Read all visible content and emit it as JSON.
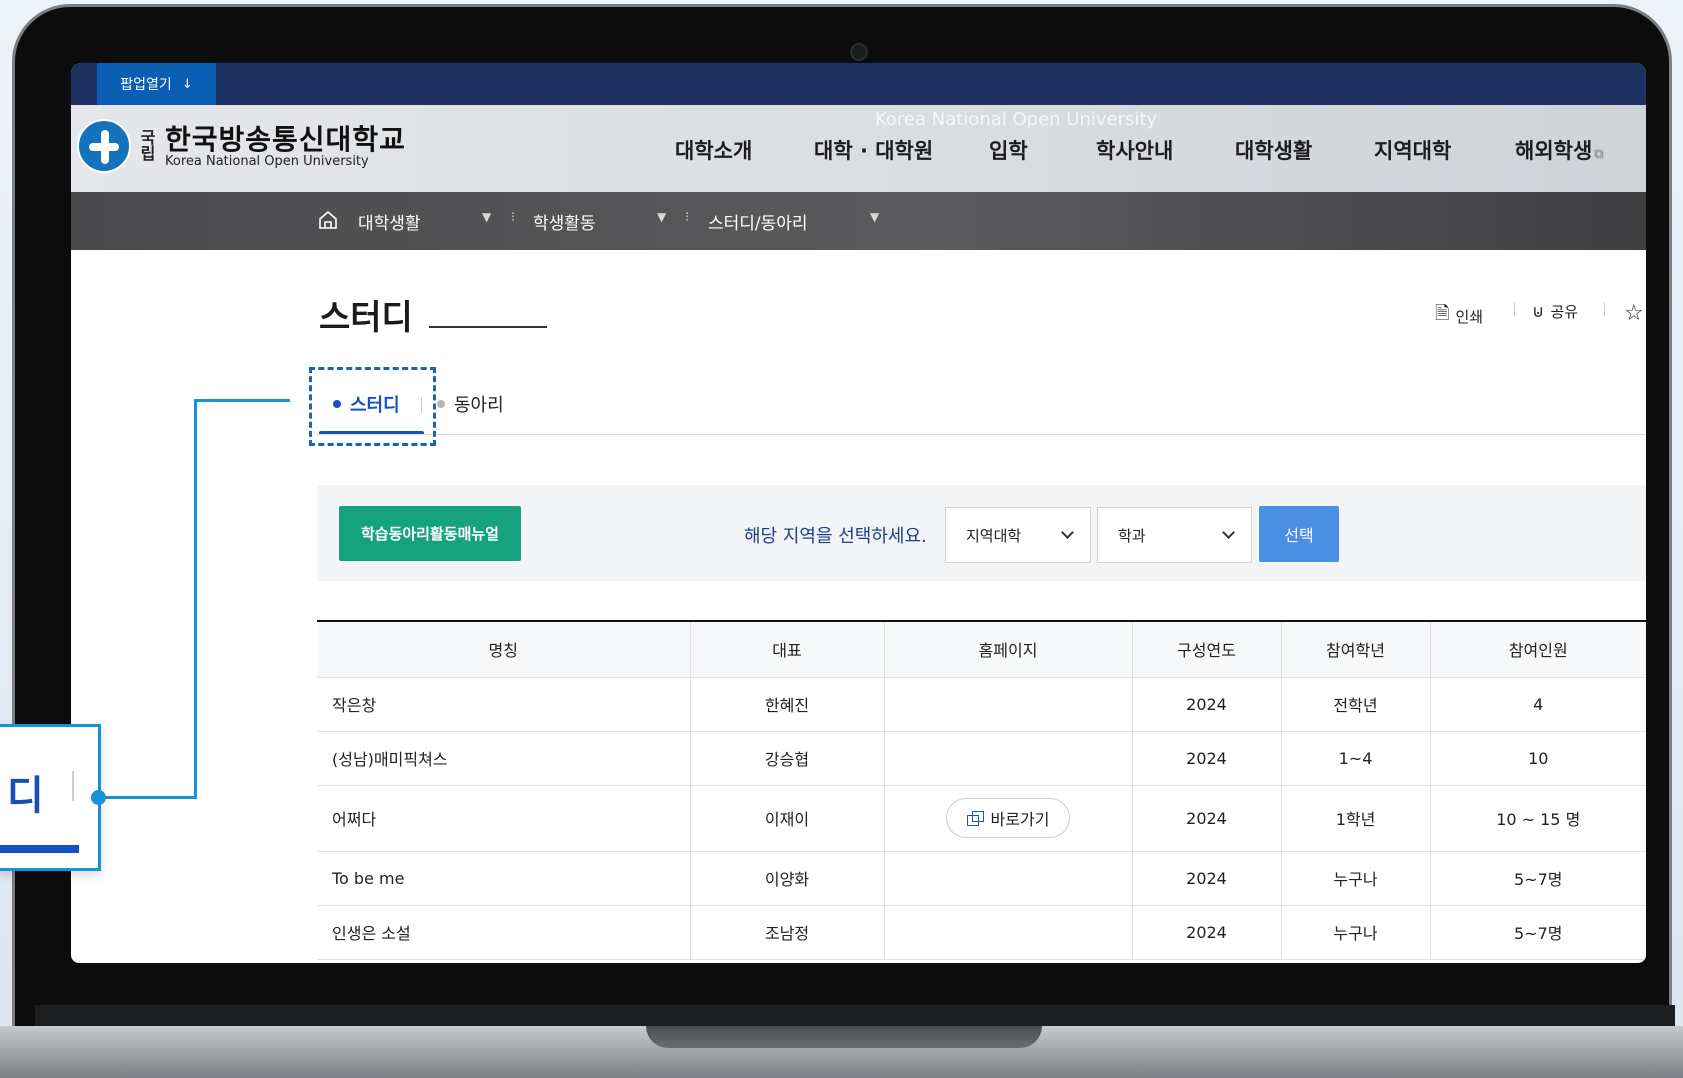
{
  "topbar": {
    "popup_label": "팝업열기",
    "popup_icon": "arrow-down-icon"
  },
  "logo": {
    "kukrip": "국립",
    "name_ko": "한국방송통신대학교",
    "name_en": "Korea National Open University"
  },
  "header": {
    "watermark": "Korea National Open University"
  },
  "gnb": [
    "대학소개",
    "대학 · 대학원",
    "입학",
    "학사안내",
    "대학생활",
    "지역대학",
    "해외학생"
  ],
  "breadcrumb": [
    "대학생활",
    "학생활동",
    "스터디/동아리"
  ],
  "page": {
    "title": "스터디",
    "utils": {
      "print": "인쇄",
      "share": "공유"
    }
  },
  "tabs": [
    {
      "label": "스터디",
      "active": true
    },
    {
      "label": "동아리",
      "active": false
    }
  ],
  "filter": {
    "manual_button": "학습동아리활동매뉴얼",
    "prompt": "해당 지역을 선택하세요.",
    "region_select": "지역대학",
    "dept_select": "학과",
    "submit": "선택"
  },
  "table": {
    "headers": [
      "명칭",
      "대표",
      "홈페이지",
      "구성연도",
      "참여학년",
      "참여인원"
    ],
    "rows": [
      {
        "name": "작은창",
        "rep": "한혜진",
        "homepage": "",
        "year": "2024",
        "grade": "전학년",
        "members": "4"
      },
      {
        "name": "(성남)매미픽쳐스",
        "rep": "강승협",
        "homepage": "",
        "year": "2024",
        "grade": "1~4",
        "members": "10"
      },
      {
        "name": "어쩌다",
        "rep": "이재이",
        "homepage": "바로가기",
        "year": "2024",
        "grade": "1학년",
        "members": "10 ~ 15 명"
      },
      {
        "name": "To be me",
        "rep": "이양화",
        "homepage": "",
        "year": "2024",
        "grade": "누구나",
        "members": "5~7명"
      },
      {
        "name": "인생은 소설",
        "rep": "조남정",
        "homepage": "",
        "year": "2024",
        "grade": "누구나",
        "members": "5~7명"
      }
    ]
  },
  "callout": {
    "text": "디"
  },
  "colors": {
    "topbar": "#1d3261",
    "accent": "#1651c4",
    "manual_button": "#16a27d",
    "select_button": "#4a8fe3",
    "callout": "#1a93d6"
  }
}
